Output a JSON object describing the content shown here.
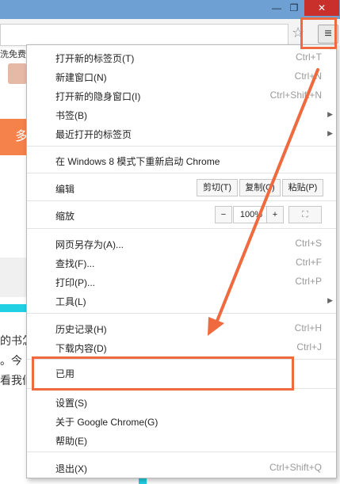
{
  "window": {
    "minimize_glyph": "—",
    "maximize_glyph": "❐",
    "close_glyph": "✕"
  },
  "page": {
    "top_text": "洗免费.",
    "orange_char": "多",
    "lines": [
      "的书怎",
      "。今",
      "看我们"
    ]
  },
  "toolbar": {
    "star_icon": "☆",
    "menu_icon": "≡"
  },
  "menu": {
    "new_tab": {
      "label": "打开新的标签页(T)",
      "shortcut": "Ctrl+T"
    },
    "new_window": {
      "label": "新建窗口(N)",
      "shortcut": "Ctrl+N"
    },
    "incognito": {
      "label": "打开新的隐身窗口(I)",
      "shortcut": "Ctrl+Shift+N"
    },
    "bookmarks": {
      "label": "书签(B)"
    },
    "recent_tabs": {
      "label": "最近打开的标签页"
    },
    "relaunch": {
      "label": "在 Windows 8 模式下重新启动 Chrome"
    },
    "edit": {
      "label": "编辑",
      "cut": "剪切(T)",
      "copy": "复制(C)",
      "paste": "粘贴(P)"
    },
    "zoom": {
      "label": "缩放",
      "minus": "−",
      "value": "100%",
      "plus": "+",
      "fullscreen": "⛶"
    },
    "save_page": {
      "label": "网页另存为(A)...",
      "shortcut": "Ctrl+S"
    },
    "find": {
      "label": "查找(F)...",
      "shortcut": "Ctrl+F"
    },
    "print": {
      "label": "打印(P)...",
      "shortcut": "Ctrl+P"
    },
    "tools": {
      "label": "工具(L)"
    },
    "history": {
      "label": "历史记录(H)",
      "shortcut": "Ctrl+H"
    },
    "downloads": {
      "label": "下载内容(D)",
      "shortcut": "Ctrl+J"
    },
    "used": {
      "label": "已用"
    },
    "settings": {
      "label": "设置(S)"
    },
    "about": {
      "label": "关于 Google Chrome(G)"
    },
    "help": {
      "label": "帮助(E)"
    },
    "exit": {
      "label": "退出(X)",
      "shortcut": "Ctrl+Shift+Q"
    },
    "submenu_arrow": "▶"
  },
  "colors": {
    "annotation": "#ef6b3f",
    "titlebar": "#6fa0d4",
    "close": "#c9302c"
  }
}
